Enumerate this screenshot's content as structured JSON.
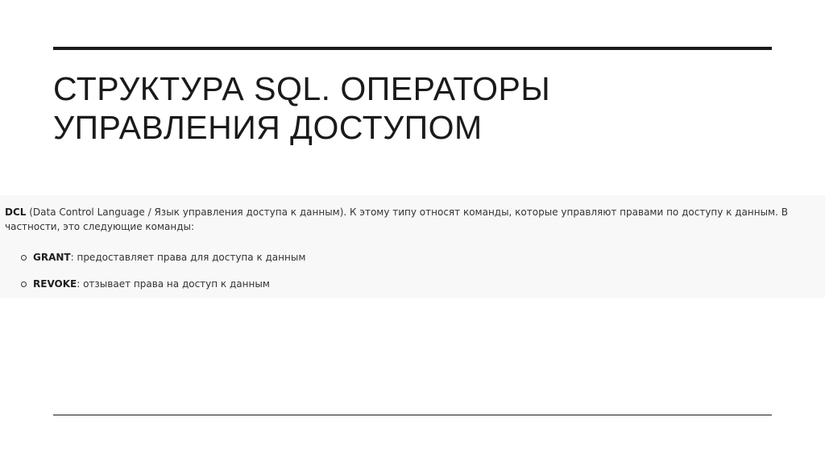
{
  "slide": {
    "title_line1": "СТРУКТУРА SQL. ОПЕРАТОРЫ",
    "title_line2": "УПРАВЛЕНИЯ ДОСТУПОМ"
  },
  "excerpt": {
    "intro_term": "DCL",
    "intro_text": " (Data Control Language / Язык управления доступа к данным). К этому типу относят команды, которые управляют правами по доступу к данным. В частности, это следующие команды:",
    "commands": [
      {
        "name": "GRANT",
        "description": ": предоставляет права для доступа к данным"
      },
      {
        "name": "REVOKE",
        "description": ": отзывает права на доступ к данным"
      }
    ]
  },
  "colors": {
    "text": "#1a1a1a",
    "excerpt_background": "#f8f8f8",
    "excerpt_text": "#333333"
  }
}
